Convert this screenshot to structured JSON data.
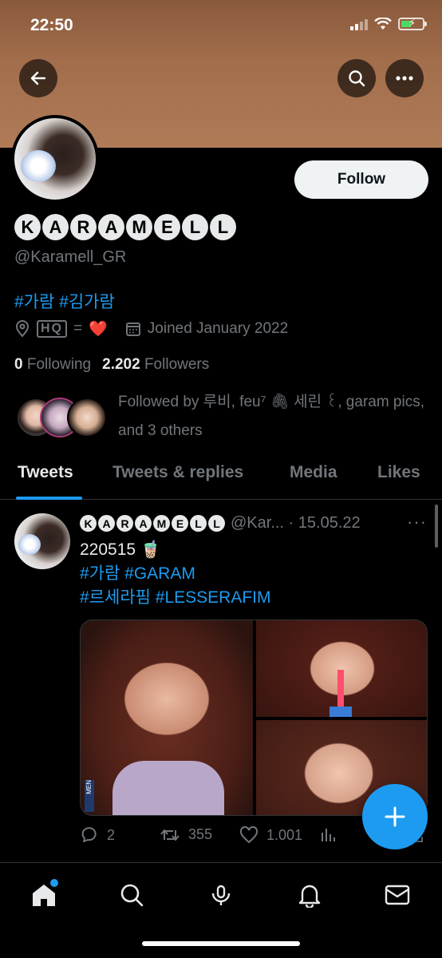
{
  "status_bar": {
    "time": "22:50"
  },
  "header": {
    "back_icon": "arrow-left-icon",
    "search_icon": "search-icon",
    "more_icon": "more-horizontal-icon"
  },
  "profile": {
    "follow_label": "Follow",
    "display_name_letters": [
      "K",
      "A",
      "R",
      "A",
      "M",
      "E",
      "L",
      "L"
    ],
    "handle": "@Karamell_GR",
    "bio": "#가람 #김가람",
    "location_boxed": "HQ",
    "location_rest": "=",
    "location_heart": "❤️",
    "joined": "Joined January 2022",
    "following_count": "0",
    "following_label": "Following",
    "followers_count": "2.202",
    "followers_label": "Followers",
    "followed_by": "Followed by 루비, feu⁷ 🖇 세린 ꒰, garam pics, and 3 others"
  },
  "tabs": [
    {
      "label": "Tweets",
      "active": true
    },
    {
      "label": "Tweets & replies",
      "active": false
    },
    {
      "label": "Media",
      "active": false
    },
    {
      "label": "Likes",
      "active": false
    }
  ],
  "tweet": {
    "name_letters": [
      "K",
      "A",
      "R",
      "A",
      "M",
      "E",
      "L",
      "L"
    ],
    "handle_date": "@Kar... · 15.05.22",
    "more": "···",
    "line1": "220515 🧋",
    "line2": "#가람 #GARAM",
    "line3": "#르세라핌 #LESSERAFIM",
    "media_label": "MEN",
    "replies": "2",
    "retweets": "355",
    "likes": "1.001"
  },
  "colors": {
    "accent": "#1d9bf0",
    "banner": "#a16d4b",
    "background": "#000000",
    "muted": "#71767b"
  },
  "bottom_nav": [
    "home-icon",
    "search-icon",
    "spaces-icon",
    "notifications-icon",
    "messages-icon"
  ]
}
